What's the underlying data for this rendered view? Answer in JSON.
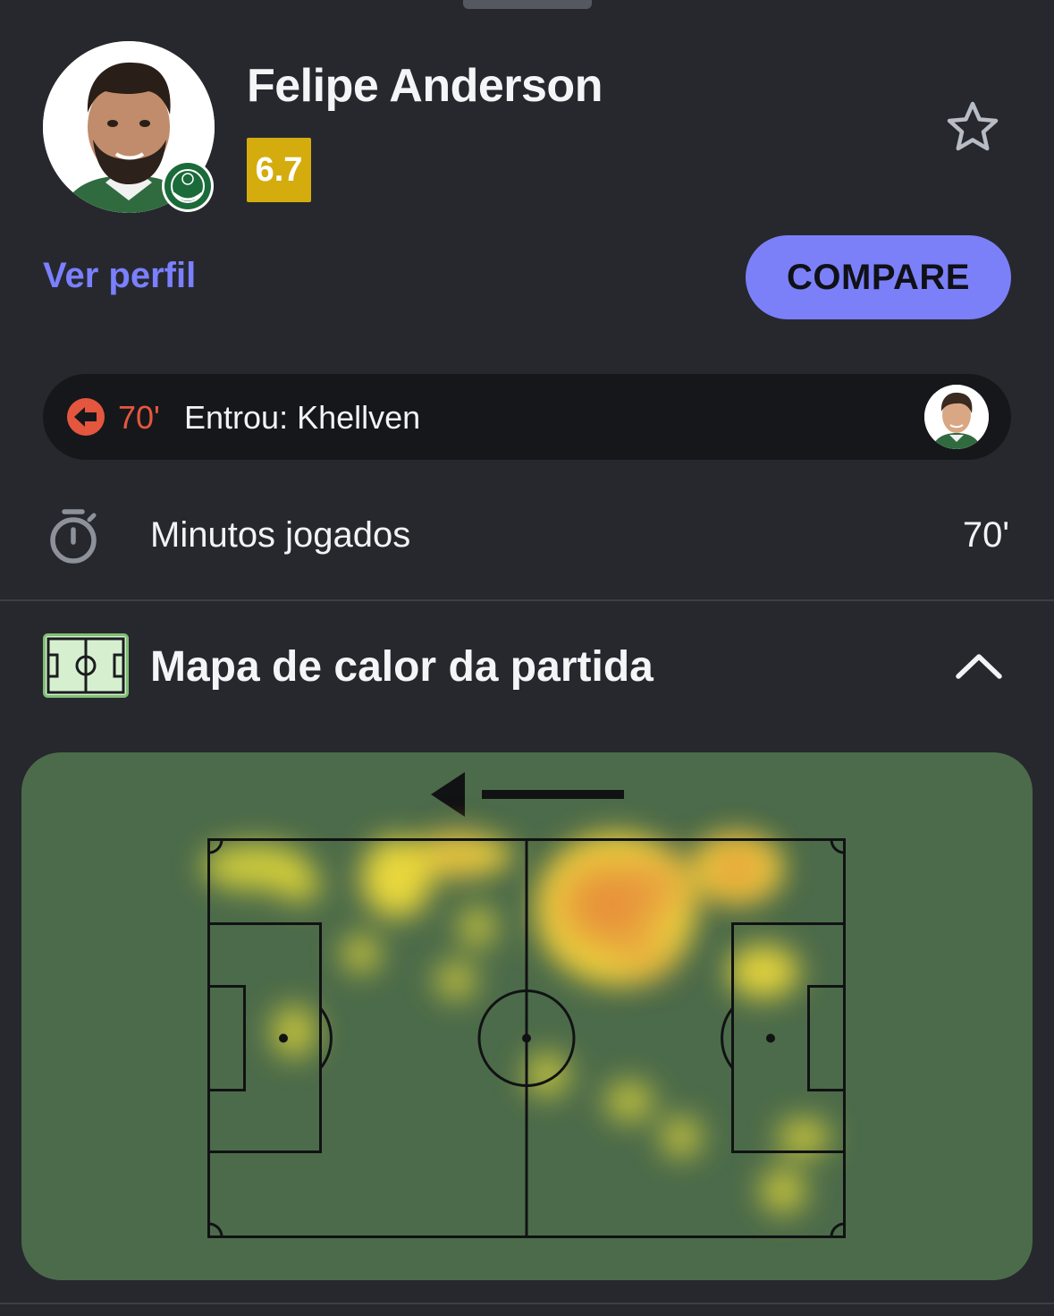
{
  "player": {
    "name": "Felipe Anderson",
    "rating": "6.7",
    "rating_color": "#d4ac0d",
    "team_badge_text": "PALMEIRAS"
  },
  "actions": {
    "profile_link": "Ver perfil",
    "compare": "COMPARE",
    "favorite_icon": "star-outline-icon"
  },
  "substitution": {
    "icon": "substitution-out-icon",
    "minute": "70'",
    "text": "Entrou: Khellven"
  },
  "stats": [
    {
      "icon": "stopwatch-icon",
      "label": "Minutos jogados",
      "value": "70'"
    }
  ],
  "heatmap_section": {
    "icon": "pitch-icon",
    "title": "Mapa de calor da partida",
    "expanded": true,
    "attack_direction": "left"
  },
  "colors": {
    "background": "#26282e",
    "accent": "#7b80f9",
    "link": "#7a80ff",
    "substitution_out": "#e4573e",
    "pitch": "#4c6b4a"
  }
}
